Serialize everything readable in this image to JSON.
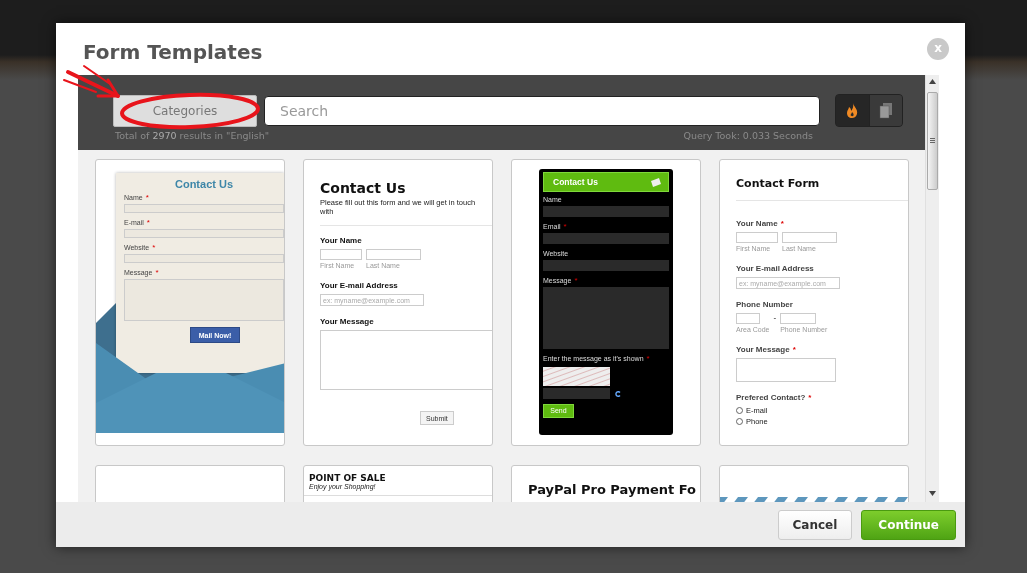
{
  "dialog": {
    "title": "Form Templates",
    "close_label": "x"
  },
  "toolbar": {
    "categories_button": "Categories",
    "search": {
      "placeholder": "Search"
    },
    "view_toggles": [
      {
        "kind": "popular",
        "selected": true
      },
      {
        "kind": "pages",
        "selected": false
      }
    ],
    "results_text": "Total of **2970** results in \"English\"",
    "query_time": "Query Took: 0.033 Seconds"
  },
  "templates": [
    {
      "kind": "envelope",
      "title": "Contact Us",
      "fields": [
        {
          "kind": "text",
          "label": "Name",
          "mark": "*"
        },
        {
          "kind": "text",
          "label": "E-mail",
          "mark": "*"
        },
        {
          "kind": "text",
          "label": "Website",
          "mark": "*"
        },
        {
          "kind": "textarea",
          "label": "Message",
          "mark": "*"
        }
      ],
      "button": "Mail Now!"
    },
    {
      "kind": "plain",
      "title": "Contact Us",
      "subtitle": "Please fill out this form and we will get in touch with",
      "fields": [
        {
          "kind": "name",
          "label": "Your Name",
          "sublabels": [
            "First Name",
            "Last Name"
          ]
        },
        {
          "kind": "email",
          "label": "Your E-mail Address",
          "placeholder": "ex: myname@example.com"
        },
        {
          "kind": "textarea",
          "label": "Your Message"
        }
      ],
      "button": "Submit"
    },
    {
      "kind": "dark",
      "title": "Contact Us",
      "fields": [
        {
          "kind": "text",
          "label": "Name"
        },
        {
          "kind": "text",
          "label": "Email",
          "mark": "*"
        },
        {
          "kind": "text",
          "label": "Website"
        },
        {
          "kind": "textarea",
          "label": "Message",
          "mark": "*"
        },
        {
          "kind": "captcha",
          "label": "Enter the message as it's shown",
          "mark": "*"
        }
      ],
      "button": "Send"
    },
    {
      "kind": "contact",
      "title": "Contact Form",
      "fields": [
        {
          "kind": "name",
          "label": "Your Name",
          "mark": "*",
          "sublabels": [
            "First Name",
            "Last Name"
          ]
        },
        {
          "kind": "email",
          "label": "Your E-mail Address",
          "placeholder": "ex: myname@example.com"
        },
        {
          "kind": "phone",
          "label": "Phone Number",
          "separator": "-",
          "sublabels": [
            "Area Code",
            "Phone Number"
          ]
        },
        {
          "kind": "textarea",
          "label": "Your Message",
          "mark": "*"
        },
        {
          "kind": "radio",
          "label": "Prefered Contact?",
          "mark": "*",
          "options": [
            "E-mail",
            "Phone"
          ]
        }
      ]
    },
    {
      "kind": "blank"
    },
    {
      "kind": "pos",
      "title": "POINT OF SALE",
      "subtitle": "Enjoy your Shopping!"
    },
    {
      "kind": "paypal",
      "title": "PayPal Pro Payment Fo"
    },
    {
      "kind": "striped"
    }
  ],
  "footer": {
    "buttons": [
      {
        "kind": "secondary",
        "label": "Cancel"
      },
      {
        "kind": "primary",
        "label": "Continue"
      }
    ]
  }
}
